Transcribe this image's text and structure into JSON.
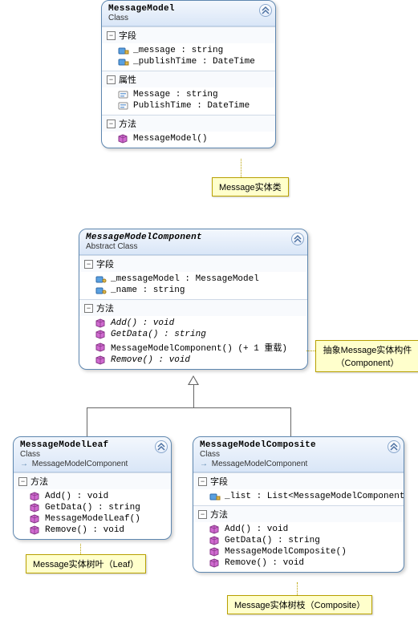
{
  "notes": {
    "n1": "Message实体类",
    "n2": "抽象Message实体构件（Component）",
    "n3": "Message实体树叶（Leaf）",
    "n4": "Message实体树枝（Composite）"
  },
  "classes": {
    "messageModel": {
      "name": "MessageModel",
      "kind": "Class",
      "sections": {
        "fields": {
          "label": "字段",
          "members": [
            {
              "icon": "field-priv",
              "sig": "_message : string"
            },
            {
              "icon": "field-priv",
              "sig": "_publishTime : DateTime"
            }
          ]
        },
        "props": {
          "label": "属性",
          "members": [
            {
              "icon": "prop",
              "sig": "Message : string"
            },
            {
              "icon": "prop",
              "sig": "PublishTime : DateTime"
            }
          ]
        },
        "methods": {
          "label": "方法",
          "members": [
            {
              "icon": "method",
              "sig": "MessageModel()"
            }
          ]
        }
      }
    },
    "component": {
      "name": "MessageModelComponent",
      "kind": "Abstract Class",
      "abstract": true,
      "sections": {
        "fields": {
          "label": "字段",
          "members": [
            {
              "icon": "field-prot",
              "sig": "_messageModel : MessageModel"
            },
            {
              "icon": "field-prot",
              "sig": "_name : string"
            }
          ]
        },
        "methods": {
          "label": "方法",
          "members": [
            {
              "icon": "method",
              "sig": "Add() : void",
              "italic": true
            },
            {
              "icon": "method",
              "sig": "GetData() : string",
              "italic": true
            },
            {
              "icon": "method",
              "sig": "MessageModelComponent() (+ 1 重载)"
            },
            {
              "icon": "method",
              "sig": "Remove() : void",
              "italic": true
            }
          ]
        }
      }
    },
    "leaf": {
      "name": "MessageModelLeaf",
      "kind": "Class",
      "inherits": "MessageModelComponent",
      "sections": {
        "methods": {
          "label": "方法",
          "members": [
            {
              "icon": "method",
              "sig": "Add() : void"
            },
            {
              "icon": "method",
              "sig": "GetData() : string"
            },
            {
              "icon": "method",
              "sig": "MessageModelLeaf()"
            },
            {
              "icon": "method",
              "sig": "Remove() : void"
            }
          ]
        }
      }
    },
    "composite": {
      "name": "MessageModelComposite",
      "kind": "Class",
      "inherits": "MessageModelComponent",
      "sections": {
        "fields": {
          "label": "字段",
          "members": [
            {
              "icon": "field-priv",
              "sig": "_list : List<MessageModelComponent>"
            }
          ]
        },
        "methods": {
          "label": "方法",
          "members": [
            {
              "icon": "method",
              "sig": "Add() : void"
            },
            {
              "icon": "method",
              "sig": "GetData() : string"
            },
            {
              "icon": "method",
              "sig": "MessageModelComposite()"
            },
            {
              "icon": "method",
              "sig": "Remove() : void"
            }
          ]
        }
      }
    }
  },
  "chart_data": {
    "type": "uml-class-diagram",
    "classes": [
      {
        "name": "MessageModel",
        "kind": "Class",
        "fields": [
          {
            "name": "_message",
            "type": "string",
            "visibility": "private"
          },
          {
            "name": "_publishTime",
            "type": "DateTime",
            "visibility": "private"
          }
        ],
        "properties": [
          {
            "name": "Message",
            "type": "string"
          },
          {
            "name": "PublishTime",
            "type": "DateTime"
          }
        ],
        "methods": [
          {
            "name": "MessageModel",
            "returns": null,
            "kind": "constructor"
          }
        ],
        "note": "Message实体类"
      },
      {
        "name": "MessageModelComponent",
        "kind": "Abstract Class",
        "fields": [
          {
            "name": "_messageModel",
            "type": "MessageModel",
            "visibility": "protected"
          },
          {
            "name": "_name",
            "type": "string",
            "visibility": "protected"
          }
        ],
        "methods": [
          {
            "name": "Add",
            "returns": "void",
            "abstract": true
          },
          {
            "name": "GetData",
            "returns": "string",
            "abstract": true
          },
          {
            "name": "MessageModelComponent",
            "returns": null,
            "kind": "constructor",
            "overloads": 1
          },
          {
            "name": "Remove",
            "returns": "void",
            "abstract": true
          }
        ],
        "note": "抽象Message实体构件（Component）"
      },
      {
        "name": "MessageModelLeaf",
        "kind": "Class",
        "extends": "MessageModelComponent",
        "methods": [
          {
            "name": "Add",
            "returns": "void"
          },
          {
            "name": "GetData",
            "returns": "string"
          },
          {
            "name": "MessageModelLeaf",
            "returns": null,
            "kind": "constructor"
          },
          {
            "name": "Remove",
            "returns": "void"
          }
        ],
        "note": "Message实体树叶（Leaf）"
      },
      {
        "name": "MessageModelComposite",
        "kind": "Class",
        "extends": "MessageModelComponent",
        "fields": [
          {
            "name": "_list",
            "type": "List<MessageModelComponent>",
            "visibility": "private"
          }
        ],
        "methods": [
          {
            "name": "Add",
            "returns": "void"
          },
          {
            "name": "GetData",
            "returns": "string"
          },
          {
            "name": "MessageModelComposite",
            "returns": null,
            "kind": "constructor"
          },
          {
            "name": "Remove",
            "returns": "void"
          }
        ],
        "note": "Message实体树枝（Composite）"
      }
    ],
    "relations": [
      {
        "from": "MessageModelLeaf",
        "to": "MessageModelComponent",
        "type": "inheritance"
      },
      {
        "from": "MessageModelComposite",
        "to": "MessageModelComponent",
        "type": "inheritance"
      }
    ]
  }
}
